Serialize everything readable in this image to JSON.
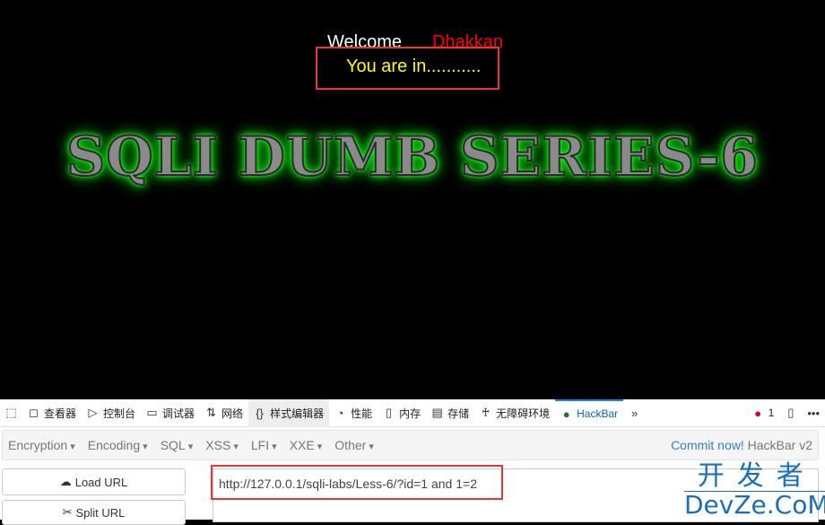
{
  "page": {
    "welcome": "Welcome",
    "user": "Dhakkan",
    "status": "You are in...........",
    "banner": "SQLI DUMB SERIES-6"
  },
  "devtools": {
    "tabs": [
      {
        "icon": "inspector-icon",
        "label": "查看器"
      },
      {
        "icon": "console-icon",
        "label": "控制台"
      },
      {
        "icon": "debugger-icon",
        "label": "调试器"
      },
      {
        "icon": "network-icon",
        "label": "网络"
      },
      {
        "icon": "style-editor-icon",
        "label": "样式编辑器"
      },
      {
        "icon": "performance-icon",
        "label": "性能"
      },
      {
        "icon": "memory-icon",
        "label": "内存"
      },
      {
        "icon": "storage-icon",
        "label": "存储"
      },
      {
        "icon": "accessibility-icon",
        "label": "无障碍环境"
      },
      {
        "icon": "hackbar-icon",
        "label": "HackBar"
      }
    ],
    "error_count": "1"
  },
  "hackbar": {
    "menus": [
      "Encryption",
      "Encoding",
      "SQL",
      "XSS",
      "LFI",
      "XXE",
      "Other"
    ],
    "commit": "Commit now!",
    "version": "HackBar v2",
    "load_url": "Load URL",
    "split_url": "Split URL",
    "url": "http://127.0.0.1/sqli-labs/Less-6/?id=1 and 1=2"
  },
  "watermark": {
    "line1": "开发者",
    "line2": "DevZe.CoM"
  },
  "colors": {
    "highlight": "#e33333",
    "accent": "#0a84ff"
  }
}
